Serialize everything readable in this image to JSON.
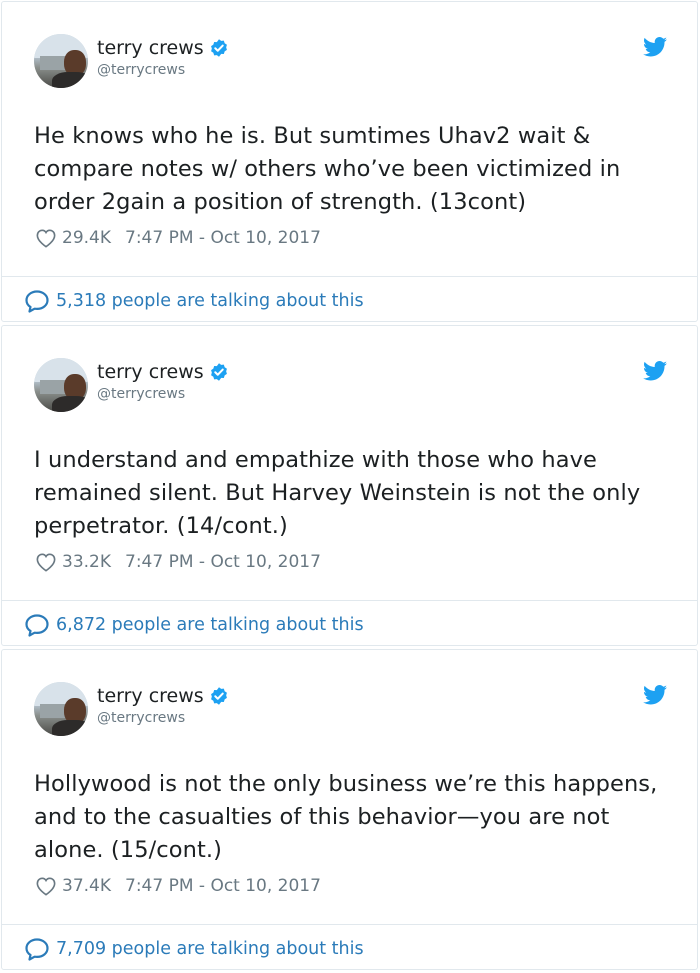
{
  "tweets": [
    {
      "author_name": "terry crews",
      "handle": "@terrycrews",
      "text": "He knows who he is. But sumtimes Uhav2 wait & compare notes w/ others who’ve been victimized in order 2gain a position of strength. (13cont)",
      "likes": "29.4K",
      "timestamp": "7:47 PM - Oct 10, 2017",
      "talking": "5,318 people are talking about this"
    },
    {
      "author_name": "terry crews",
      "handle": "@terrycrews",
      "text": "I understand and empathize with those who have remained silent. But Harvey Weinstein is not the only perpetrator. (14/cont.)",
      "likes": "33.2K",
      "timestamp": "7:47 PM - Oct 10, 2017",
      "talking": "6,872 people are talking about this"
    },
    {
      "author_name": "terry crews",
      "handle": "@terrycrews",
      "text": "Hollywood is not the only business we’re this happens, and to the casualties of this behavior—you are not alone. (15/cont.)",
      "likes": "37.4K",
      "timestamp": "7:47 PM - Oct 10, 2017",
      "talking": "7,709 people are talking about this"
    }
  ],
  "icons": {
    "verified": "verified-badge-icon",
    "bird": "twitter-bird-icon",
    "heart": "heart-icon",
    "bubble": "speech-bubble-icon"
  },
  "colors": {
    "twitter_blue": "#1da1f2",
    "link_blue": "#2b7bb9",
    "meta_gray": "#697882",
    "text": "#1c2022",
    "border": "#e1e8ed"
  }
}
